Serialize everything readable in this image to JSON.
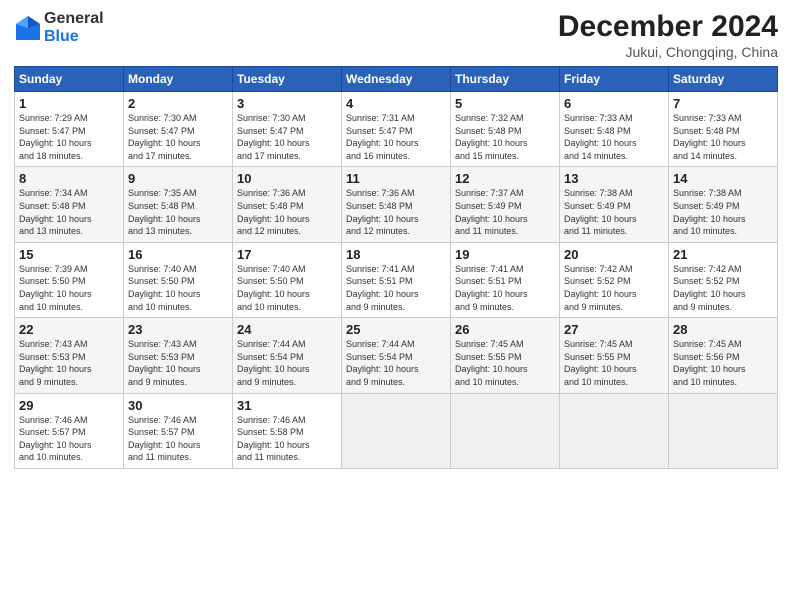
{
  "header": {
    "logo_general": "General",
    "logo_blue": "Blue",
    "title": "December 2024",
    "subtitle": "Jukui, Chongqing, China"
  },
  "days_of_week": [
    "Sunday",
    "Monday",
    "Tuesday",
    "Wednesday",
    "Thursday",
    "Friday",
    "Saturday"
  ],
  "weeks": [
    [
      {
        "day": "1",
        "info": "Sunrise: 7:29 AM\nSunset: 5:47 PM\nDaylight: 10 hours\nand 18 minutes."
      },
      {
        "day": "2",
        "info": "Sunrise: 7:30 AM\nSunset: 5:47 PM\nDaylight: 10 hours\nand 17 minutes."
      },
      {
        "day": "3",
        "info": "Sunrise: 7:30 AM\nSunset: 5:47 PM\nDaylight: 10 hours\nand 17 minutes."
      },
      {
        "day": "4",
        "info": "Sunrise: 7:31 AM\nSunset: 5:47 PM\nDaylight: 10 hours\nand 16 minutes."
      },
      {
        "day": "5",
        "info": "Sunrise: 7:32 AM\nSunset: 5:48 PM\nDaylight: 10 hours\nand 15 minutes."
      },
      {
        "day": "6",
        "info": "Sunrise: 7:33 AM\nSunset: 5:48 PM\nDaylight: 10 hours\nand 14 minutes."
      },
      {
        "day": "7",
        "info": "Sunrise: 7:33 AM\nSunset: 5:48 PM\nDaylight: 10 hours\nand 14 minutes."
      }
    ],
    [
      {
        "day": "8",
        "info": "Sunrise: 7:34 AM\nSunset: 5:48 PM\nDaylight: 10 hours\nand 13 minutes."
      },
      {
        "day": "9",
        "info": "Sunrise: 7:35 AM\nSunset: 5:48 PM\nDaylight: 10 hours\nand 13 minutes."
      },
      {
        "day": "10",
        "info": "Sunrise: 7:36 AM\nSunset: 5:48 PM\nDaylight: 10 hours\nand 12 minutes."
      },
      {
        "day": "11",
        "info": "Sunrise: 7:36 AM\nSunset: 5:48 PM\nDaylight: 10 hours\nand 12 minutes."
      },
      {
        "day": "12",
        "info": "Sunrise: 7:37 AM\nSunset: 5:49 PM\nDaylight: 10 hours\nand 11 minutes."
      },
      {
        "day": "13",
        "info": "Sunrise: 7:38 AM\nSunset: 5:49 PM\nDaylight: 10 hours\nand 11 minutes."
      },
      {
        "day": "14",
        "info": "Sunrise: 7:38 AM\nSunset: 5:49 PM\nDaylight: 10 hours\nand 10 minutes."
      }
    ],
    [
      {
        "day": "15",
        "info": "Sunrise: 7:39 AM\nSunset: 5:50 PM\nDaylight: 10 hours\nand 10 minutes."
      },
      {
        "day": "16",
        "info": "Sunrise: 7:40 AM\nSunset: 5:50 PM\nDaylight: 10 hours\nand 10 minutes."
      },
      {
        "day": "17",
        "info": "Sunrise: 7:40 AM\nSunset: 5:50 PM\nDaylight: 10 hours\nand 10 minutes."
      },
      {
        "day": "18",
        "info": "Sunrise: 7:41 AM\nSunset: 5:51 PM\nDaylight: 10 hours\nand 9 minutes."
      },
      {
        "day": "19",
        "info": "Sunrise: 7:41 AM\nSunset: 5:51 PM\nDaylight: 10 hours\nand 9 minutes."
      },
      {
        "day": "20",
        "info": "Sunrise: 7:42 AM\nSunset: 5:52 PM\nDaylight: 10 hours\nand 9 minutes."
      },
      {
        "day": "21",
        "info": "Sunrise: 7:42 AM\nSunset: 5:52 PM\nDaylight: 10 hours\nand 9 minutes."
      }
    ],
    [
      {
        "day": "22",
        "info": "Sunrise: 7:43 AM\nSunset: 5:53 PM\nDaylight: 10 hours\nand 9 minutes."
      },
      {
        "day": "23",
        "info": "Sunrise: 7:43 AM\nSunset: 5:53 PM\nDaylight: 10 hours\nand 9 minutes."
      },
      {
        "day": "24",
        "info": "Sunrise: 7:44 AM\nSunset: 5:54 PM\nDaylight: 10 hours\nand 9 minutes."
      },
      {
        "day": "25",
        "info": "Sunrise: 7:44 AM\nSunset: 5:54 PM\nDaylight: 10 hours\nand 9 minutes."
      },
      {
        "day": "26",
        "info": "Sunrise: 7:45 AM\nSunset: 5:55 PM\nDaylight: 10 hours\nand 10 minutes."
      },
      {
        "day": "27",
        "info": "Sunrise: 7:45 AM\nSunset: 5:55 PM\nDaylight: 10 hours\nand 10 minutes."
      },
      {
        "day": "28",
        "info": "Sunrise: 7:45 AM\nSunset: 5:56 PM\nDaylight: 10 hours\nand 10 minutes."
      }
    ],
    [
      {
        "day": "29",
        "info": "Sunrise: 7:46 AM\nSunset: 5:57 PM\nDaylight: 10 hours\nand 10 minutes."
      },
      {
        "day": "30",
        "info": "Sunrise: 7:46 AM\nSunset: 5:57 PM\nDaylight: 10 hours\nand 11 minutes."
      },
      {
        "day": "31",
        "info": "Sunrise: 7:46 AM\nSunset: 5:58 PM\nDaylight: 10 hours\nand 11 minutes."
      },
      null,
      null,
      null,
      null
    ]
  ]
}
